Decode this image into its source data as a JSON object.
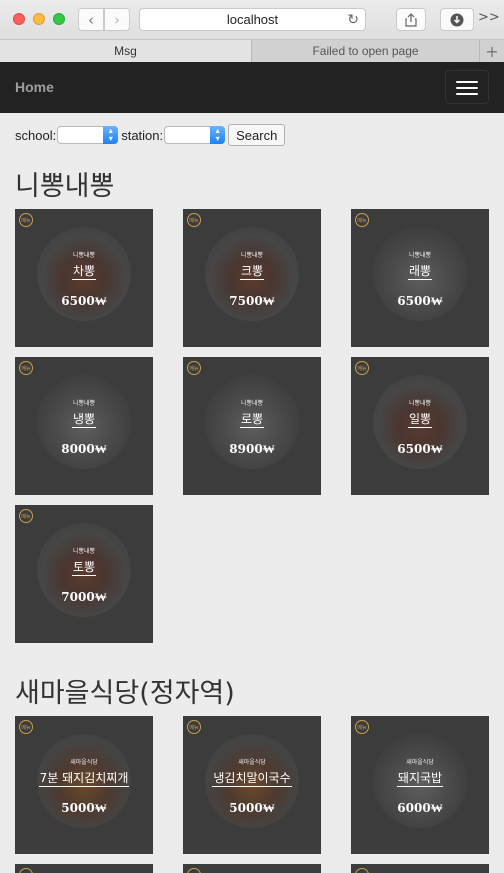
{
  "browser": {
    "url": "localhost",
    "tabs": [
      {
        "label": "Msg",
        "active": true
      },
      {
        "label": "Failed to open page",
        "active": false
      }
    ],
    "new_tab": "+",
    "overflow": ">>"
  },
  "navbar": {
    "brand": "Home"
  },
  "form": {
    "school_label": "school:",
    "school_value": "",
    "station_label": "station:",
    "station_value": "",
    "search_label": "Search"
  },
  "sections": [
    {
      "title": "니뽕내뽕",
      "items": [
        {
          "shop": "니뽕내뽕",
          "menu": "차뽕",
          "price": "6500₩"
        },
        {
          "shop": "니뽕내뽕",
          "menu": "크뽕",
          "price": "7500₩"
        },
        {
          "shop": "니뽕내뽕",
          "menu": "래뽕",
          "price": "6500₩"
        },
        {
          "shop": "니뽕내뽕",
          "menu": "냉뽕",
          "price": "8000₩"
        },
        {
          "shop": "니뽕내뽕",
          "menu": "로뽕",
          "price": "8900₩"
        },
        {
          "shop": "니뽕내뽕",
          "menu": "일뽕",
          "price": "6500₩"
        },
        {
          "shop": "니뽕내뽕",
          "menu": "토뽕",
          "price": "7000₩"
        }
      ]
    },
    {
      "title": "새마을식당(정자역)",
      "items": [
        {
          "shop": "새마을식당",
          "menu": "7분 돼지김치찌개",
          "price": "5000₩"
        },
        {
          "shop": "새마을식당",
          "menu": "냉김치말이국수",
          "price": "5000₩"
        },
        {
          "shop": "새마을식당",
          "menu": "돼지국밥",
          "price": "6000₩"
        }
      ]
    }
  ],
  "badge_text": "메뉴",
  "colors": {
    "navbar_bg": "#222222",
    "card_bg": "#3c3c3c",
    "badge": "#c8a24e"
  }
}
